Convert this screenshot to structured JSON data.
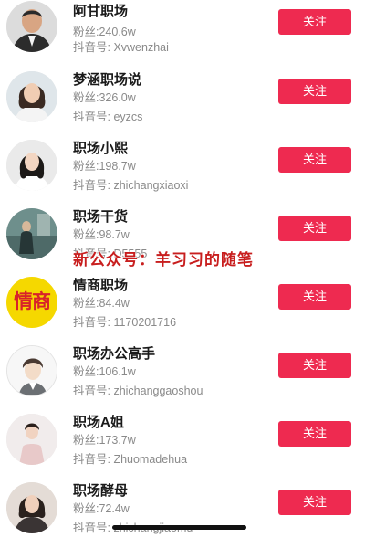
{
  "accounts": [
    {
      "name": "阿甘职场",
      "fans": "粉丝:240.6w",
      "douyin": "抖音号: Xvwenzhai",
      "follow": "关注",
      "avatar": "male-avatar"
    },
    {
      "name": "梦涵职场说",
      "fans": "粉丝:326.0w",
      "douyin": "抖音号: eyzcs",
      "follow": "关注",
      "avatar": "female-avatar"
    },
    {
      "name": "职场小熙",
      "fans": "粉丝:198.7w",
      "douyin": "抖音号: zhichangxiaoxi",
      "follow": "关注",
      "avatar": "female-avatar"
    },
    {
      "name": "职场干货",
      "fans": "粉丝:98.7w",
      "douyin": "抖音号: D5555",
      "follow": "关注",
      "avatar": "photo-avatar"
    },
    {
      "name": "情商职场",
      "fans": "粉丝:84.4w",
      "douyin": "抖音号: 1170201716",
      "follow": "关注",
      "avatar": "text-logo-avatar",
      "avatar_text": "情商"
    },
    {
      "name": "职场办公高手",
      "fans": "粉丝:106.1w",
      "douyin": "抖音号: zhichanggaoshou",
      "follow": "关注",
      "avatar": "cartoon-avatar"
    },
    {
      "name": "职场A姐",
      "fans": "粉丝:173.7w",
      "douyin": "抖音号: Zhuomadehua",
      "follow": "关注",
      "avatar": "female-avatar"
    },
    {
      "name": "职场酵母",
      "fans": "粉丝:72.4w",
      "douyin": "抖音号: zhichangjiaomu",
      "follow": "关注",
      "avatar": "female-avatar"
    }
  ],
  "watermark": "新公众号：羊习习的随笔",
  "colors": {
    "follow_button": "#ee2a50",
    "watermark": "#c81e1e",
    "logo_bg": "#f5d800",
    "logo_text": "#d8232a"
  }
}
